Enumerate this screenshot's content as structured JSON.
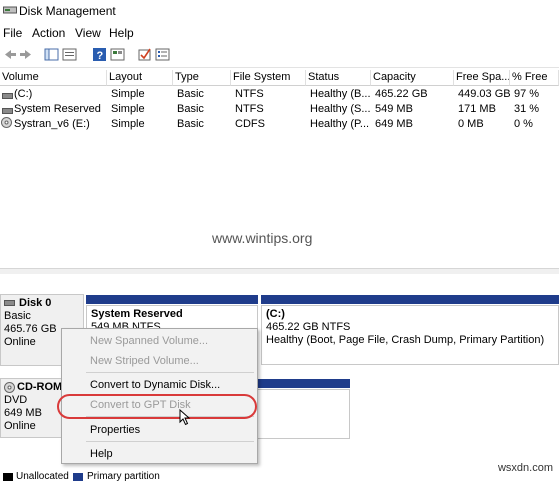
{
  "window": {
    "title": "Disk Management"
  },
  "menu": [
    "File",
    "Action",
    "View",
    "Help"
  ],
  "toolbar_icons": [
    "back-icon",
    "forward-icon",
    "console-tree-icon",
    "properties-icon",
    "help-icon",
    "rescan-icon",
    "checklist-icon",
    "detail-view-icon"
  ],
  "volume_table": {
    "columns": [
      "Volume",
      "Layout",
      "Type",
      "File System",
      "Status",
      "Capacity",
      "Free Spa...",
      "% Free"
    ],
    "rows": [
      [
        "(C:)",
        "Simple",
        "Basic",
        "NTFS",
        "Healthy (B...",
        "465.22 GB",
        "449.03 GB",
        "97 %"
      ],
      [
        "System Reserved",
        "Simple",
        "Basic",
        "NTFS",
        "Healthy (S...",
        "549 MB",
        "171 MB",
        "31 %"
      ],
      [
        "Systran_v6 (E:)",
        "Simple",
        "Basic",
        "CDFS",
        "Healthy (P...",
        "649 MB",
        "0 MB",
        "0 %"
      ]
    ]
  },
  "watermark": "www.wintips.org",
  "disk0": {
    "name": "Disk 0",
    "type": "Basic",
    "size": "465.76 GB",
    "state": "Online",
    "partition_reserved": {
      "name": "System Reserved",
      "detail": "549 MB NTFS"
    },
    "partition_c": {
      "name": "(C:)",
      "size": "465.22 GB NTFS",
      "status": "Healthy (Boot, Page File, Crash Dump, Primary Partition)"
    }
  },
  "cdrom": {
    "name": "CD-ROM",
    "type": "DVD",
    "size": "649 MB",
    "state": "Online"
  },
  "context_menu": {
    "items": [
      {
        "label": "New Spanned Volume...",
        "enabled": false
      },
      {
        "label": "New Striped Volume...",
        "enabled": false
      },
      {
        "label": "Convert to Dynamic Disk...",
        "enabled": true
      },
      {
        "label": "Convert to GPT Disk",
        "enabled": false
      },
      {
        "label": "Properties",
        "enabled": true
      },
      {
        "label": "Help",
        "enabled": true
      }
    ]
  },
  "legend": {
    "unallocated": "Unallocated",
    "primary": "Primary partition"
  },
  "site_id": "wsxdn.com",
  "colors": {
    "partition_bar": "#1f3c8b",
    "highlight_ring": "#d93a3a",
    "unallocated": "#000000"
  }
}
